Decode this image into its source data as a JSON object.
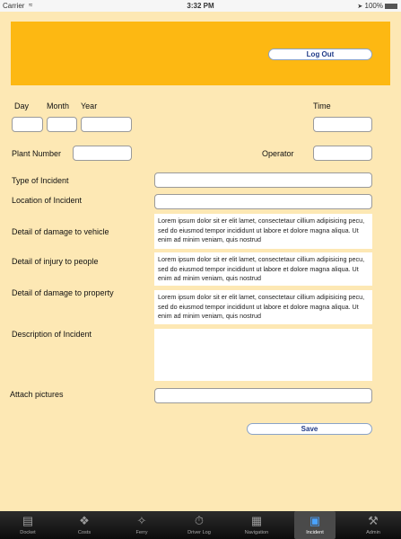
{
  "status": {
    "carrier": "Carrier",
    "time": "3:32 PM",
    "battery": "100%"
  },
  "header": {
    "logout_label": "Log Out"
  },
  "form": {
    "day_label": "Day",
    "month_label": "Month",
    "year_label": "Year",
    "time_label": "Time",
    "plant_number_label": "Plant Number",
    "operator_label": "Operator",
    "type_label": "Type of Incident",
    "location_label": "Location of Incident",
    "vehicle_damage_label": "Detail of damage to vehicle",
    "vehicle_damage_text": "Lorem ipsum dolor sit er elit lamet, consectetaur cillium adipisicing pecu, sed do eiusmod tempor incididunt ut labore et dolore magna aliqua. Ut enim ad minim veniam, quis nostrud",
    "injury_label": "Detail of injury to people",
    "injury_text": "Lorem ipsum dolor sit er elit lamet, consectetaur cillium adipisicing pecu, sed do eiusmod tempor incididunt ut labore et dolore magna aliqua. Ut enim ad minim veniam, quis nostrud",
    "property_damage_label": "Detail of damage to property",
    "property_damage_text": "Lorem ipsum dolor sit er elit lamet, consectetaur cillium adipisicing pecu, sed do eiusmod tempor incididunt ut labore et dolore magna aliqua. Ut enim ad minim veniam, quis nostrud",
    "description_label": "Description of Incident",
    "attach_label": "Attach pictures",
    "save_label": "Save"
  },
  "tabs": [
    {
      "label": "Docket",
      "icon": "book-icon"
    },
    {
      "label": "Costs",
      "icon": "tag-icon"
    },
    {
      "label": "Ferry",
      "icon": "ferry-icon"
    },
    {
      "label": "Driver Log",
      "icon": "stopwatch-icon"
    },
    {
      "label": "Navigation",
      "icon": "map-icon"
    },
    {
      "label": "Incident",
      "icon": "briefcase-icon",
      "active": true
    },
    {
      "label": "Admin",
      "icon": "wrench-icon"
    }
  ],
  "colors": {
    "header": "#fdb812",
    "background": "#fde8b4",
    "accent": "#1f3a87"
  }
}
